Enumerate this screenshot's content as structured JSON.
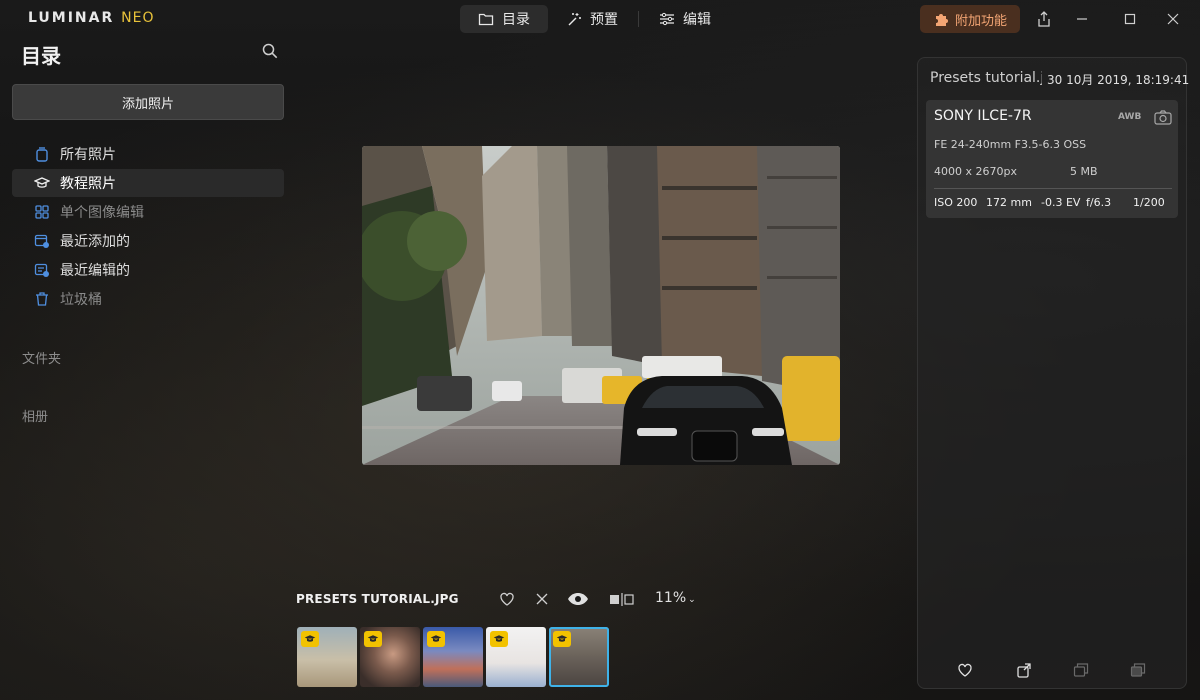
{
  "app": {
    "logo_main": "LUMINAR",
    "logo_accent": "NEO"
  },
  "mode_tabs": [
    {
      "label": "目录",
      "icon": "folder-icon",
      "active": true
    },
    {
      "label": "预置",
      "icon": "magic-wand-icon",
      "active": false
    },
    {
      "label": "编辑",
      "icon": "sliders-icon",
      "active": false
    }
  ],
  "addon": {
    "label": "附加功能",
    "icon": "puzzle-icon",
    "accent": "#f3a574"
  },
  "sidebar": {
    "title": "目录",
    "add_photos": "添加照片",
    "items": [
      {
        "label": "所有照片",
        "icon": "photo-stack-icon"
      },
      {
        "label": "教程照片",
        "icon": "graduation-cap-icon",
        "active": true
      },
      {
        "label": "单个图像编辑",
        "icon": "grid-icon",
        "dim": true
      },
      {
        "label": "最近添加的",
        "icon": "calendar-added-icon"
      },
      {
        "label": "最近编辑的",
        "icon": "calendar-edited-icon"
      },
      {
        "label": "垃圾桶",
        "icon": "trash-icon",
        "dim": true
      }
    ],
    "folders_label": "文件夹",
    "albums_label": "相册"
  },
  "viewer": {
    "file_name": "PRESETS TUTORIAL.JPG",
    "zoom": "11%"
  },
  "info": {
    "title": "Presets tutorial.jpg",
    "date": "30 10月 2019, 18:19:41",
    "camera": "SONY ILCE-7R",
    "wb": "AWB",
    "lens": "FE 24-240mm F3.5-6.3 OSS",
    "resolution": "4000 x 2670px",
    "size": "5 MB",
    "iso": "ISO 200",
    "focal": "172 mm",
    "ev": "-0.3 EV",
    "aperture": "f/6.3",
    "shutter": "1/200"
  },
  "colors": {
    "accent": "#3fb2e8",
    "badge": "#f2c200",
    "addon_bg": "#4a2f1f"
  }
}
